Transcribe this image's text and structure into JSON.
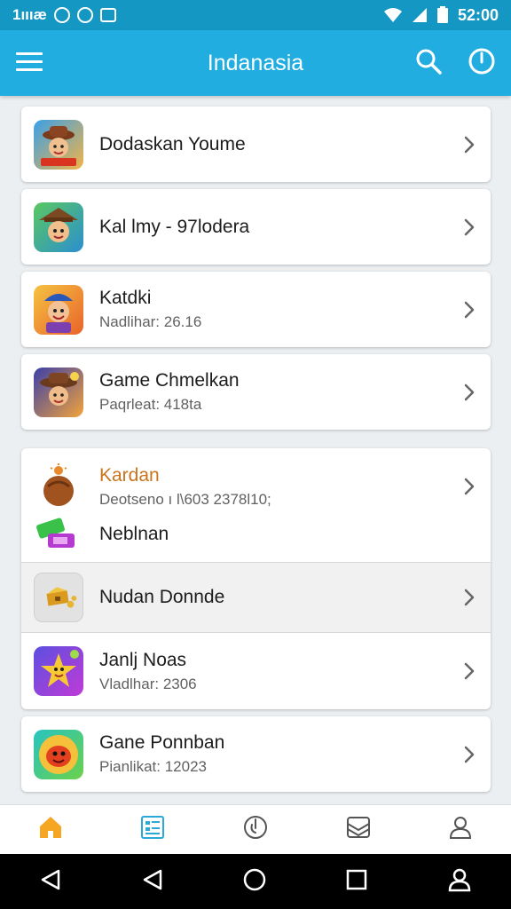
{
  "status": {
    "left_text": "1ıııæ",
    "time": "52:00"
  },
  "header": {
    "title": "Indanasia"
  },
  "single_items": [
    {
      "title": "Dodaskan Youme",
      "subtitle": "",
      "icon": "cowboy-game-icon"
    },
    {
      "title": "Kal lmy - 97lodera",
      "subtitle": "",
      "icon": "explorer-game-icon"
    },
    {
      "title": "Katdki",
      "subtitle": "Nadlihar: 26.16",
      "icon": "hero-game-icon"
    },
    {
      "title": "Game Chmelkan",
      "subtitle": "Paqrleat: 418ta",
      "icon": "adventurer-game-icon"
    }
  ],
  "group_items": [
    {
      "title": "Kardan",
      "subtitle": "Deotseno ı l\\603 2378l10;",
      "icon": "coconut-icon",
      "title_color": "#c9741c",
      "chevron": true,
      "highlight": false
    },
    {
      "title": "Neblnan",
      "subtitle": "",
      "icon": "ticket-icon",
      "chevron": false,
      "highlight": false
    },
    {
      "title": "Nudan Donnde",
      "subtitle": "",
      "icon": "treasure-icon",
      "chevron": true,
      "highlight": true
    },
    {
      "title": "Janlj Noas",
      "subtitle": "Vladlhar: 2306",
      "icon": "star-creature-icon",
      "chevron": true,
      "highlight": false
    }
  ],
  "last_item": {
    "title": "Gane Ponnban",
    "subtitle": "Pianlikat: 12023",
    "icon": "red-blob-icon"
  },
  "colors": {
    "status_bar": "#1597c4",
    "app_bar": "#22ade0",
    "accent_home": "#f5a623",
    "accent_active": "#2aa8d8"
  },
  "nav_icons": [
    "home-icon",
    "list-icon",
    "power-icon",
    "inbox-icon",
    "profile-icon"
  ]
}
